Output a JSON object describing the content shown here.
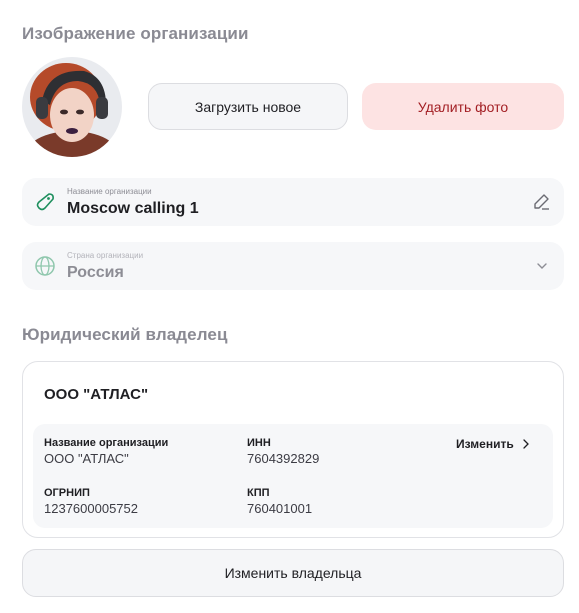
{
  "image_section": {
    "title": "Изображение организации",
    "upload_label": "Загрузить новое",
    "delete_label": "Удалить фото"
  },
  "name_field": {
    "label": "Название организации",
    "value": "Moscow calling 1",
    "icon": "tag-icon",
    "action_icon": "edit-pencil-icon"
  },
  "country_field": {
    "label": "Страна организации",
    "value": "Россия",
    "icon": "globe-icon",
    "action_icon": "chevron-down-icon"
  },
  "owner_section": {
    "title": "Юридический владелец",
    "owner_name": "ООО \"АТЛАС\"",
    "details": {
      "org_name_label": "Название организации",
      "org_name_value": "ООО \"АТЛАС\"",
      "inn_label": "ИНН",
      "inn_value": "7604392829",
      "ogrnip_label": "ОГРНИП",
      "ogrnip_value": "1237600005752",
      "kpp_label": "КПП",
      "kpp_value": "760401001",
      "change_label": "Изменить"
    },
    "change_owner_label": "Изменить владельца"
  },
  "colors": {
    "accent_green": "#1e8f5e",
    "delete_bg": "#fde3e3",
    "delete_text": "#a31f24",
    "muted_text": "#8a8a93"
  }
}
